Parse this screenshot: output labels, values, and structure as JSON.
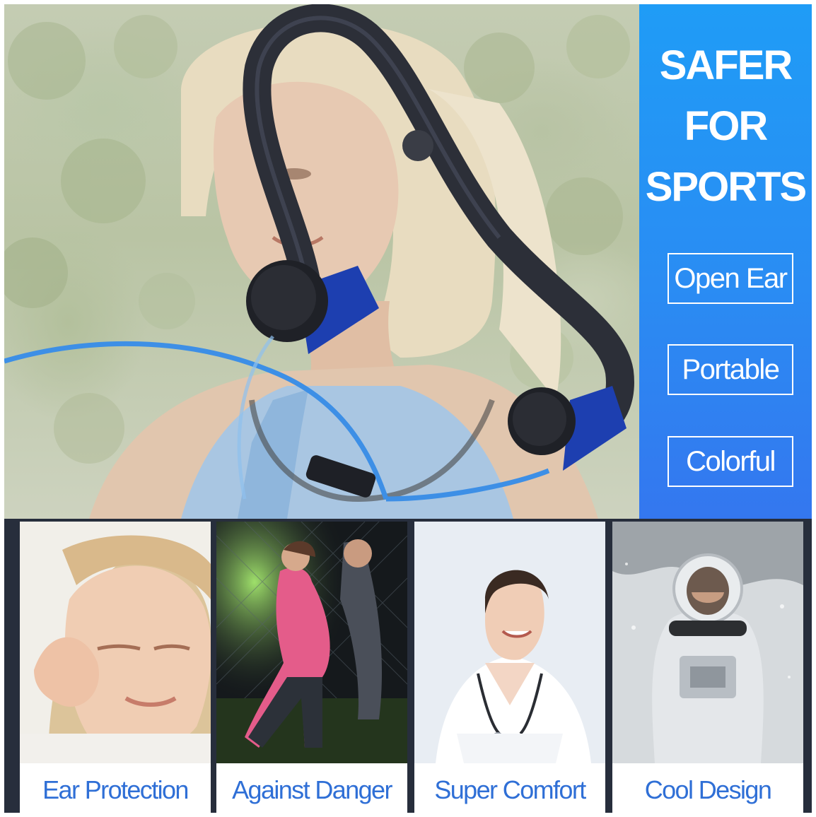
{
  "hero": {
    "headline": [
      "SAFER",
      "FOR",
      "SPORTS"
    ],
    "features": [
      "Open Ear",
      "Portable",
      "Colorful"
    ]
  },
  "cards": [
    {
      "label": "Ear Protection",
      "scene": "child covering ears"
    },
    {
      "label": "Against Danger",
      "scene": "night runners"
    },
    {
      "label": "Super Comfort",
      "scene": "smiling doctor"
    },
    {
      "label": "Cool Design",
      "scene": "astronaut in snow"
    }
  ],
  "colors": {
    "panel_blue": "#2a8cf3",
    "label_blue": "#2f6fd6",
    "strip_dark": "#272e3c",
    "headphone_accent": "#1d3fb0",
    "cable_blue": "#3d8fe6"
  }
}
